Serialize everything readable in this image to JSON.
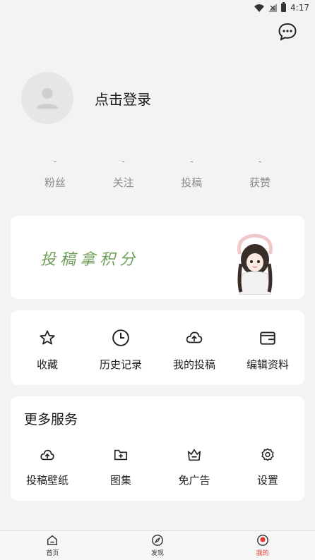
{
  "status_bar": {
    "time": "4:17",
    "icons": [
      "wifi-icon",
      "no-signal-icon",
      "battery-icon"
    ]
  },
  "header": {
    "message_icon": "chat-bubble-icon"
  },
  "profile": {
    "login_label": "点击登录",
    "avatar_icon": "default-user-icon"
  },
  "stats": [
    {
      "value": "-",
      "label": "粉丝"
    },
    {
      "value": "-",
      "label": "关注"
    },
    {
      "value": "-",
      "label": "投稿"
    },
    {
      "value": "-",
      "label": "获赞"
    }
  ],
  "banner": {
    "text": "投稿拿积分",
    "image": "anime-girl-illustration"
  },
  "quick_actions": [
    {
      "label": "收藏",
      "icon": "star-icon"
    },
    {
      "label": "历史记录",
      "icon": "clock-icon"
    },
    {
      "label": "我的投稿",
      "icon": "cloud-upload-icon"
    },
    {
      "label": "编辑资料",
      "icon": "wallet-icon"
    }
  ],
  "more_services": {
    "title": "更多服务",
    "items": [
      {
        "label": "投稿壁纸",
        "icon": "cloud-upload-icon"
      },
      {
        "label": "图集",
        "icon": "folder-plus-icon"
      },
      {
        "label": "免广告",
        "icon": "crown-icon"
      },
      {
        "label": "设置",
        "icon": "gear-icon"
      }
    ]
  },
  "tabbar": [
    {
      "label": "首页",
      "icon": "home-icon",
      "active": false
    },
    {
      "label": "发现",
      "icon": "compass-icon",
      "active": false
    },
    {
      "label": "我的",
      "icon": "profile-icon",
      "active": true
    }
  ],
  "colors": {
    "accent": "#e53935",
    "banner_text": "#6f9e5a",
    "background": "#f3f3f3"
  }
}
